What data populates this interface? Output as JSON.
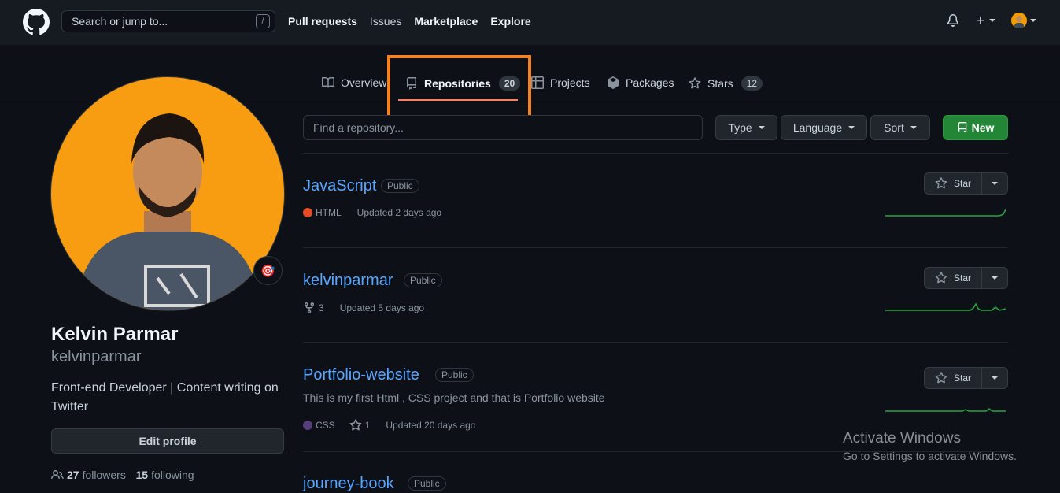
{
  "header": {
    "search_placeholder": "Search or jump to...",
    "search_shortcut": "/",
    "nav": [
      "Pull requests",
      "Issues",
      "Marketplace",
      "Explore"
    ]
  },
  "tabs": [
    {
      "label": "Overview",
      "icon": "book-icon"
    },
    {
      "label": "Repositories",
      "count": "20",
      "icon": "repo-icon",
      "active": true
    },
    {
      "label": "Projects",
      "icon": "table-icon"
    },
    {
      "label": "Packages",
      "icon": "package-icon"
    },
    {
      "label": "Stars",
      "count": "12",
      "icon": "star-icon"
    }
  ],
  "profile": {
    "name": "Kelvin Parmar",
    "login": "kelvinparmar",
    "bio": "Front-end Developer | Content writing on Twitter",
    "edit_label": "Edit profile",
    "followers_count": "27",
    "followers_label": "followers",
    "following_count": "15",
    "following_label": "following",
    "separator": "·",
    "status_emoji": "🎯"
  },
  "filters": {
    "find_placeholder": "Find a repository...",
    "type_label": "Type",
    "language_label": "Language",
    "sort_label": "Sort",
    "new_label": "New"
  },
  "repos": [
    {
      "name": "JavaScript",
      "visibility": "Public",
      "language": "HTML",
      "language_color": "#e34c26",
      "updated": "Updated 2 days ago"
    },
    {
      "name": "kelvinparmar",
      "visibility": "Public",
      "forks": "3",
      "updated": "Updated 5 days ago"
    },
    {
      "name": "Portfolio-website",
      "visibility": "Public",
      "description": "This is my first Html , CSS project and that is Portfolio website",
      "language": "CSS",
      "language_color": "#563d7c",
      "stars": "1",
      "updated": "Updated 20 days ago"
    },
    {
      "name": "journey-book",
      "visibility": "Public"
    }
  ],
  "star_label": "Star",
  "watermark": {
    "line1": "Activate Windows",
    "line2": "Go to Settings to activate Windows."
  },
  "colors": {
    "accent_underline": "#f78166",
    "highlight_box": "#f58220",
    "link": "#58a6ff",
    "new_button": "#238636"
  }
}
